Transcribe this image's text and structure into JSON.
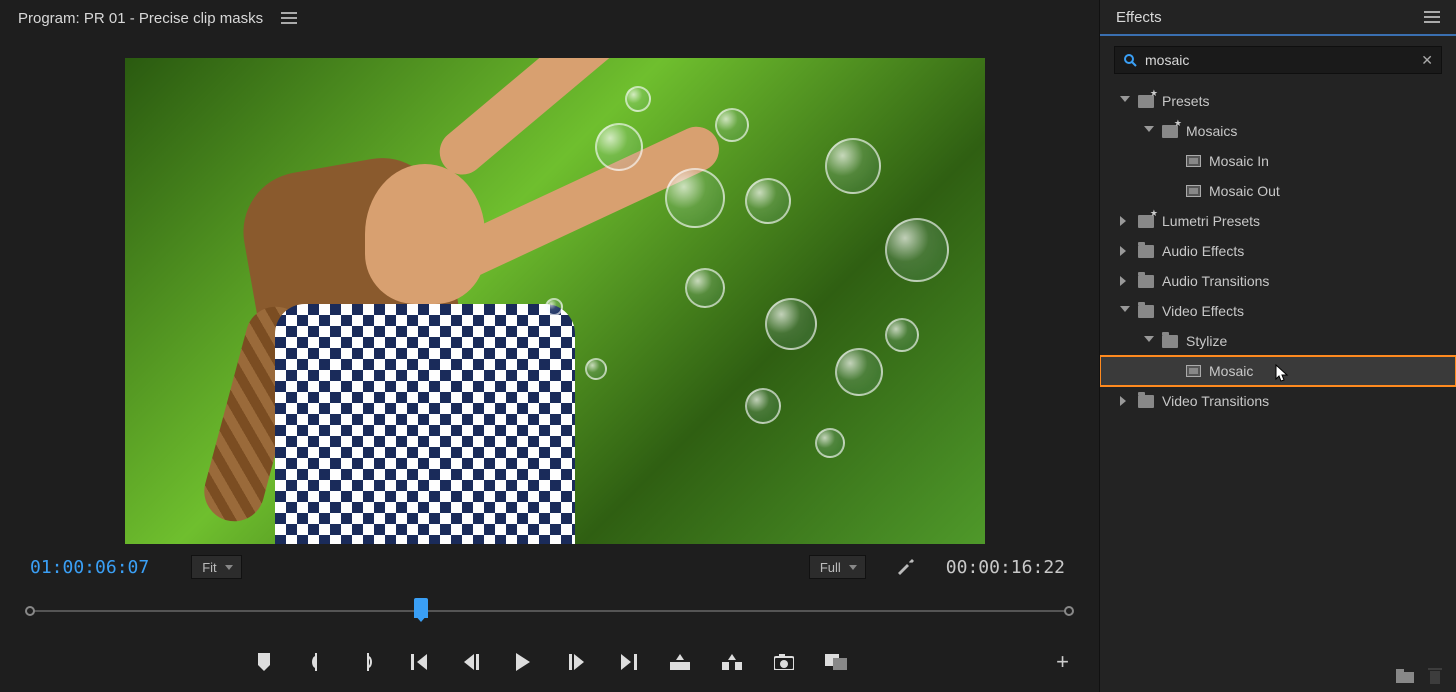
{
  "program": {
    "title_prefix": "Program: ",
    "sequence_name": "PR 01 - Precise clip masks",
    "current_timecode": "01:00:06:07",
    "duration_timecode": "00:00:16:22",
    "zoom_fit": "Fit",
    "resolution": "Full",
    "playhead_percent": 37
  },
  "effects": {
    "title": "Effects",
    "search_value": "mosaic",
    "tree": {
      "presets": "Presets",
      "mosaics": "Mosaics",
      "mosaic_in": "Mosaic In",
      "mosaic_out": "Mosaic Out",
      "lumetri_presets": "Lumetri Presets",
      "audio_effects": "Audio Effects",
      "audio_transitions": "Audio Transitions",
      "video_effects": "Video Effects",
      "stylize": "Stylize",
      "mosaic": "Mosaic",
      "video_transitions": "Video Transitions"
    }
  }
}
